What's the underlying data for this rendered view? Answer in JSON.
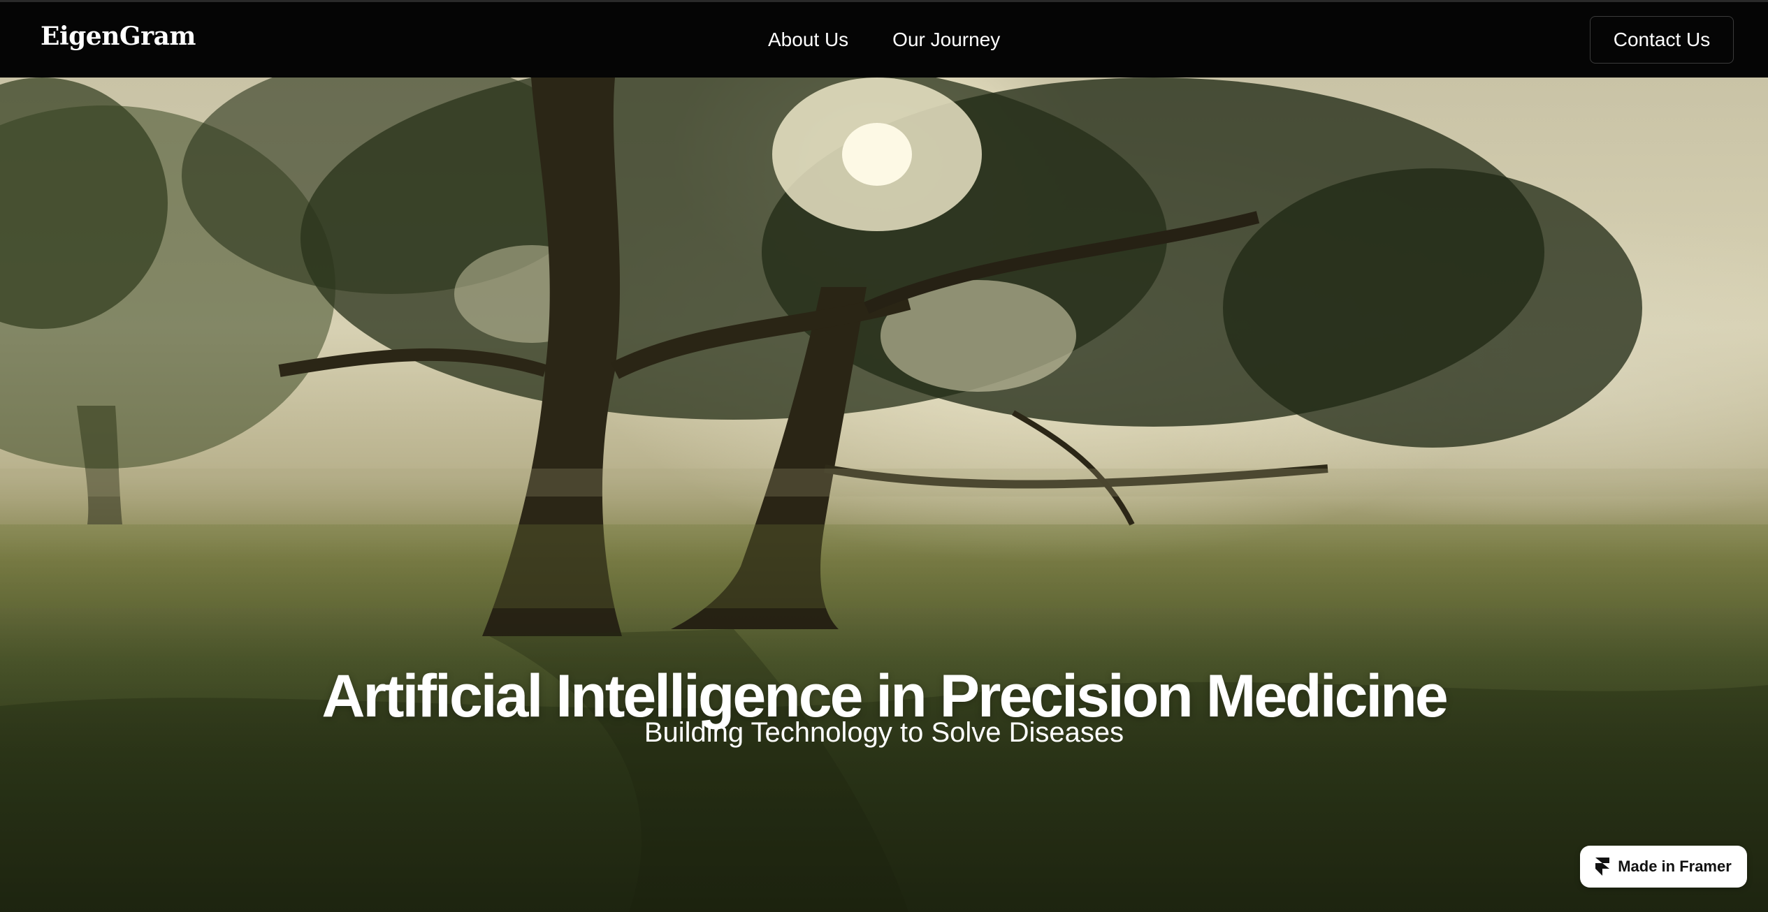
{
  "nav": {
    "logo": "EigenGram",
    "links": [
      "About Us",
      "Our Journey"
    ],
    "contact_label": "Contact Us"
  },
  "hero": {
    "title": "Artificial Intelligence in Precision Medicine",
    "subtitle": "Building Technology to Solve Diseases",
    "background": "misty-forest-trees-image"
  },
  "badge": {
    "label": "Made in Framer",
    "icon": "framer-icon"
  },
  "colors": {
    "navbar_bg": "#050505",
    "text": "#ffffff",
    "badge_bg": "#ffffff"
  }
}
